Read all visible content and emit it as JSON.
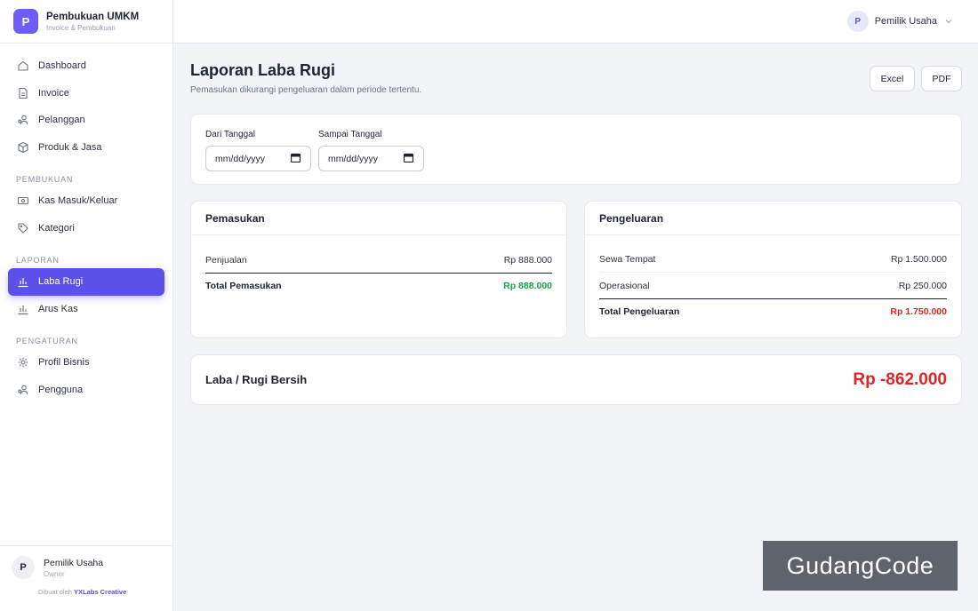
{
  "brand": {
    "logo_letter": "P",
    "title": "Pembukuan UMKM",
    "subtitle": "Invoice & Pembukuan"
  },
  "sidebar": {
    "items_main": [
      {
        "label": "Dashboard",
        "icon": "home-icon"
      },
      {
        "label": "Invoice",
        "icon": "document-icon"
      },
      {
        "label": "Pelanggan",
        "icon": "users-icon"
      },
      {
        "label": "Produk & Jasa",
        "icon": "box-icon"
      }
    ],
    "section_pembukuan": "PEMBUKUAN",
    "items_pembukuan": [
      {
        "label": "Kas Masuk/Keluar",
        "icon": "cash-icon"
      },
      {
        "label": "Kategori",
        "icon": "tag-icon"
      }
    ],
    "section_laporan": "LAPORAN",
    "items_laporan": [
      {
        "label": "Laba Rugi",
        "icon": "bar-chart-icon",
        "active": true
      },
      {
        "label": "Arus Kas",
        "icon": "bar-chart-icon"
      }
    ],
    "section_pengaturan": "PENGATURAN",
    "items_pengaturan": [
      {
        "label": "Profil Bisnis",
        "icon": "gear-icon"
      },
      {
        "label": "Pengguna",
        "icon": "users-icon"
      }
    ]
  },
  "profile": {
    "avatar_letter": "P",
    "name": "Pemilik Usaha",
    "role": "Owner",
    "credit_prefix": "Dibuat oleh",
    "credit_name": "YXLabs Creative"
  },
  "topbar": {
    "avatar_letter": "P",
    "user_name": "Pemilik Usaha"
  },
  "page": {
    "title": "Laporan Laba Rugi",
    "subtitle": "Pemasukan dikurangi pengeluaran dalam periode tertentu.",
    "export_excel": "Excel",
    "export_pdf": "PDF"
  },
  "filter": {
    "from_label": "Dari Tanggal",
    "from_placeholder": "mm/dd/yyyy",
    "to_label": "Sampai Tanggal",
    "to_placeholder": "mm/dd/yyyy"
  },
  "income": {
    "title": "Pemasukan",
    "rows": [
      {
        "label": "Penjualan",
        "value": "Rp 888.000"
      }
    ],
    "total_label": "Total Pemasukan",
    "total_value": "Rp 888.000"
  },
  "expense": {
    "title": "Pengeluaran",
    "rows": [
      {
        "label": "Sewa Tempat",
        "value": "Rp 1.500.000"
      },
      {
        "label": "Operasional",
        "value": "Rp 250.000"
      }
    ],
    "total_label": "Total Pengeluaran",
    "total_value": "Rp 1.750.000"
  },
  "net": {
    "label": "Laba / Rugi Bersih",
    "value": "Rp -862.000"
  },
  "colors": {
    "accent": "#5b50e8",
    "positive": "#16a34a",
    "negative": "#dc2626"
  },
  "watermark": "GudangCode"
}
